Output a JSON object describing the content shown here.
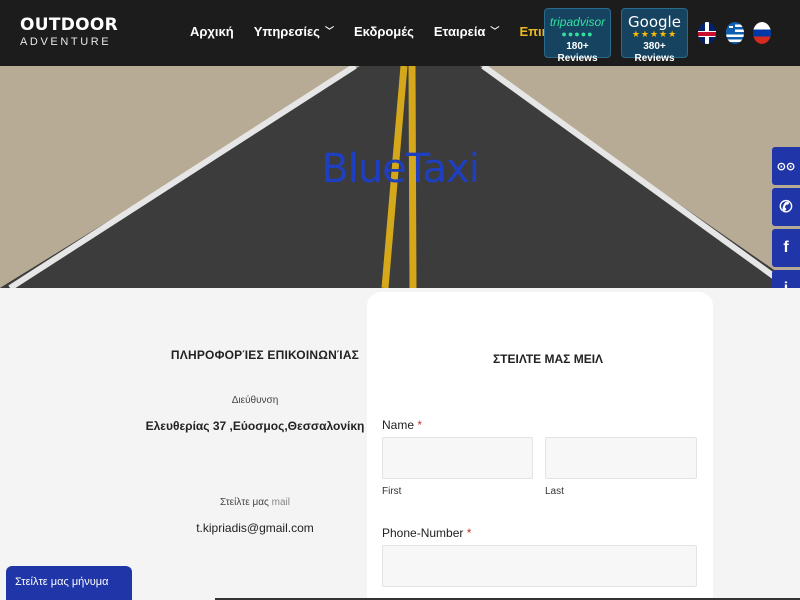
{
  "logo": {
    "top": "OUTDOOR",
    "bottom": "ADVENTURE"
  },
  "nav": {
    "items": [
      {
        "label": "Αρχική",
        "dropdown": false,
        "active": false
      },
      {
        "label": "Υπηρεσίες",
        "dropdown": true,
        "active": false
      },
      {
        "label": "Εκδρομές",
        "dropdown": false,
        "active": false
      },
      {
        "label": "Εταιρεία",
        "dropdown": true,
        "active": false
      },
      {
        "label": "Επικοινωνία",
        "dropdown": false,
        "active": true
      }
    ],
    "active_color": "#e8b923"
  },
  "badges": {
    "tripadvisor": {
      "name": "tripadvisor",
      "stars": "●●●●●",
      "reviews": "180+ Reviews"
    },
    "google": {
      "name": "Google",
      "stars": "★★★★★",
      "reviews": "380+ Reviews"
    }
  },
  "languages": [
    "uk-flag-icon",
    "greece-flag-icon",
    "russia-flag-icon"
  ],
  "hero": {
    "title": "BlueTaxi",
    "title_color": "#1e3fbf"
  },
  "side_bar": {
    "icons": [
      "tripadvisor-icon",
      "phone-icon",
      "facebook-icon",
      "info-icon",
      "instagram-icon",
      "book-icon"
    ],
    "glyphs": [
      "⊙⊙",
      "✆",
      "f",
      "i",
      "◎",
      "▤"
    ],
    "color": "#1f35a8"
  },
  "contact_info": {
    "title": "ΠΛΗΡΟΦΟΡΊΕΣ ΕΠΙΚΟΙΝΩΝΊΑΣ",
    "address_label": "Διεύθυνση",
    "address": "Ελευθερίας 37 ,Εύοσμος,Θεσσαλονίκη",
    "mail_label_prefix": "Στείλτε μας",
    "mail_label_word": "mail",
    "email": "t.kipriadis@gmail.com"
  },
  "form": {
    "title": "ΣΤΕΙΛΤΕ ΜΑΣ ΜΕΙΛ",
    "name_label": "Name",
    "required_mark": "*",
    "first_label": "First",
    "last_label": "Last",
    "phone_label": "Phone-Number"
  },
  "message_button": "Στείλτε μας μήνυμα"
}
